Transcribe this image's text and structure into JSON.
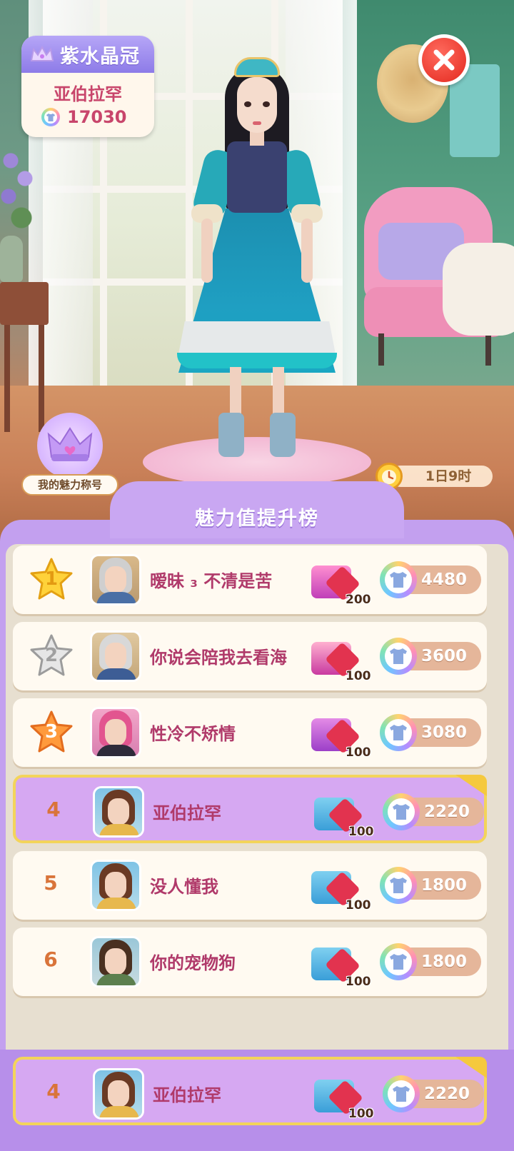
{
  "title_card": {
    "title": "紫水晶冠",
    "owner": "亚伯拉罕",
    "charm_value": "17030"
  },
  "badge": {
    "label": "我的魅力称号"
  },
  "timer": {
    "text": "1日9时"
  },
  "panel": {
    "title": "魅力值提升榜"
  },
  "rows": [
    {
      "rank": "1",
      "name": "暧昧 ₃ 不清是苦",
      "reward_qty": "200",
      "charm": "4480"
    },
    {
      "rank": "2",
      "name": "你说会陪我去看海",
      "reward_qty": "100",
      "charm": "3600"
    },
    {
      "rank": "3",
      "name": "性冷不矫情",
      "reward_qty": "100",
      "charm": "3080"
    },
    {
      "rank": "4",
      "name": "亚伯拉罕",
      "reward_qty": "100",
      "charm": "2220"
    },
    {
      "rank": "5",
      "name": "没人懂我",
      "reward_qty": "100",
      "charm": "1800"
    },
    {
      "rank": "6",
      "name": "你的宠物狗",
      "reward_qty": "100",
      "charm": "1800"
    }
  ],
  "me": {
    "rank": "4",
    "name": "亚伯拉罕",
    "reward_qty": "100",
    "charm": "2220"
  },
  "colors": {
    "accent_purple": "#c3a0ef",
    "highlight_row": "#d6a8f2",
    "name_text": "#b03a6a",
    "rank_text": "#d9743a",
    "close_red": "#e3281e"
  },
  "icons": {
    "close": "close-icon",
    "crown": "crown-icon",
    "charm": "charm-tshirt-icon",
    "clock": "alarm-clock-icon",
    "chest": "treasure-chest-icon",
    "gem": "ruby-gem-icon",
    "star": "rank-star-icon"
  }
}
